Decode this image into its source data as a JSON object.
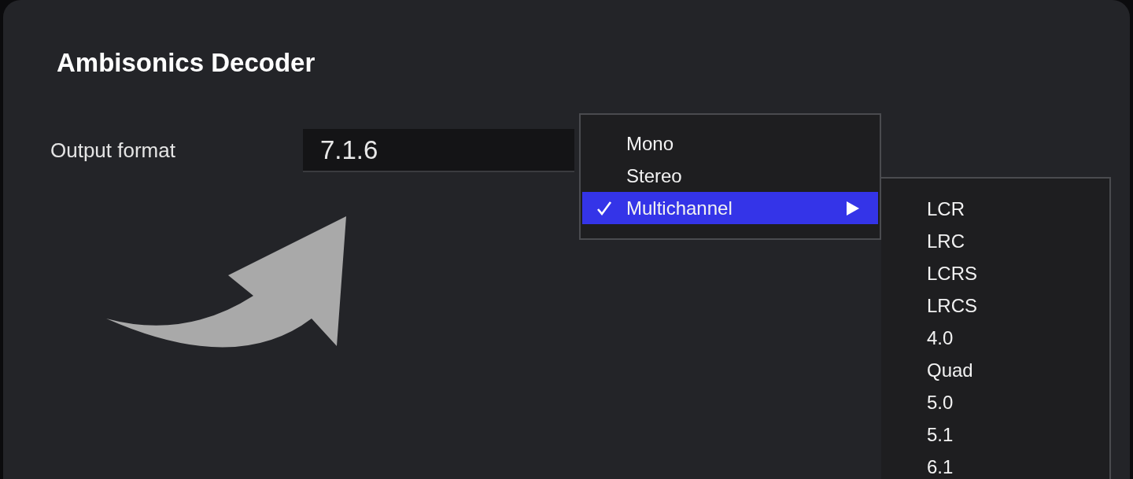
{
  "panel": {
    "title": "Ambisonics Decoder"
  },
  "output_format": {
    "label": "Output format",
    "value": "7.1.6"
  },
  "menu": {
    "items": [
      {
        "label": "Mono",
        "selected": false,
        "checked": false,
        "submenu": false
      },
      {
        "label": "Stereo",
        "selected": false,
        "checked": false,
        "submenu": false
      },
      {
        "label": "Multichannel",
        "selected": true,
        "checked": true,
        "submenu": true
      }
    ]
  },
  "submenu": {
    "items": [
      {
        "label": "LCR",
        "selected": false
      },
      {
        "label": "LRC",
        "selected": false
      },
      {
        "label": "LCRS",
        "selected": false
      },
      {
        "label": "LRCS",
        "selected": false
      },
      {
        "label": "4.0",
        "selected": false
      },
      {
        "label": "Quad",
        "selected": false
      },
      {
        "label": "5.0",
        "selected": false
      },
      {
        "label": "5.1",
        "selected": false
      },
      {
        "label": "6.1",
        "selected": false
      }
    ]
  }
}
